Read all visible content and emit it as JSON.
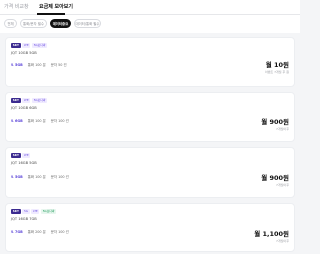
{
  "top_tabs": [
    "가격 비교창",
    "요금제 모아보기"
  ],
  "filter_chips": [
    "전체",
    "통화/문자 필수",
    "데이터중요",
    "데이터/통화 필수"
  ],
  "colors": {
    "accent": "#5a43d8",
    "badge_dark": "#3b2a8f",
    "chip_active": "#111111"
  },
  "plans": [
    {
      "badges": [
        "SKT",
        "LTE",
        "5G보다싸"
      ],
      "name": "JQT 10GB 5GB",
      "data": "⇅ 5GB",
      "call": "통화 100 분",
      "sms": "문자 50 건",
      "price": "월 10원",
      "price_sub": "이벤트 7개월 후 원"
    },
    {
      "badges": [
        "SKT",
        "LTE",
        "5G보다싸"
      ],
      "name": "JQT 10GB 6GB",
      "data": "⇅ 6GB",
      "call": "통화 100 분",
      "sms": "문자 100 건",
      "price": "월 900원",
      "price_sub": "7개월이후"
    },
    {
      "badges": [
        "SKT",
        "LTE"
      ],
      "name": "JQT 16GB 5GB",
      "data": "⇅ 5GB",
      "call": "통화 100 분",
      "sms": "문자 100 건",
      "price": "월 900원",
      "price_sub": "7개월이후"
    },
    {
      "badges": [
        "SKT",
        "5G",
        "LTE",
        "5G보다싸"
      ],
      "name": "JQT 16GB 7GB",
      "data": "⇅ 7GB",
      "call": "통화 200 분",
      "sms": "문자 100 건",
      "price": "월 1,100원",
      "price_sub": "7개월이후"
    }
  ]
}
